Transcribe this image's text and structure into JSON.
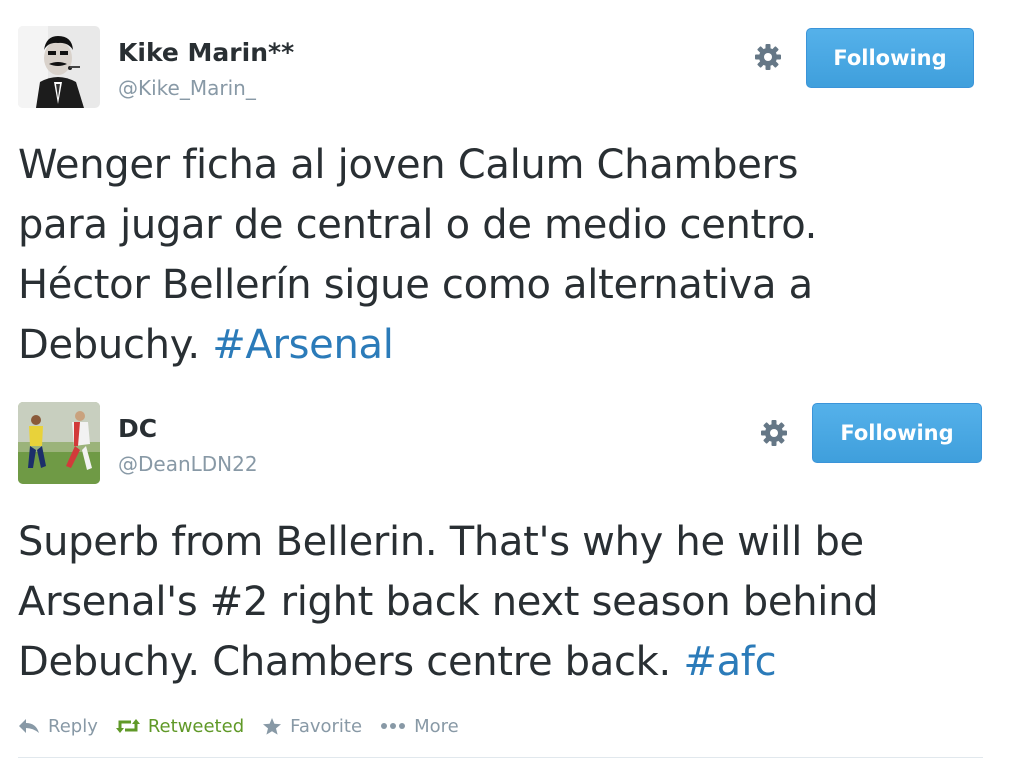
{
  "tweets": [
    {
      "name": "Kike Marin**",
      "handle": "@Kike_Marin_",
      "follow_label": "Following",
      "text_lines": [
        "Wenger ficha al joven Calum Chambers",
        "para jugar de central o de medio centro.",
        "Héctor Bellerín sigue como alternativa a",
        "Debuchy. "
      ],
      "hashtag": "#Arsenal"
    },
    {
      "name": "DC",
      "handle": "@DeanLDN22",
      "follow_label": "Following",
      "text_lines": [
        "Superb from Bellerin. That's why he will be",
        "Arsenal's #2 right back next season behind",
        "Debuchy. Chambers centre back. "
      ],
      "hashtag": "#afc"
    }
  ],
  "actions": {
    "reply": "Reply",
    "retweeted": "Retweeted",
    "favorite": "Favorite",
    "more": "More"
  },
  "colors": {
    "follow_button": "#4aa8e4",
    "hashtag": "#2b7bb9",
    "retweeted": "#609928",
    "muted": "#8899a6"
  },
  "icons": {
    "settings": "gear-icon",
    "reply": "reply-arrow-icon",
    "retweet": "retweet-icon",
    "favorite": "star-icon",
    "more": "ellipsis-icon"
  }
}
